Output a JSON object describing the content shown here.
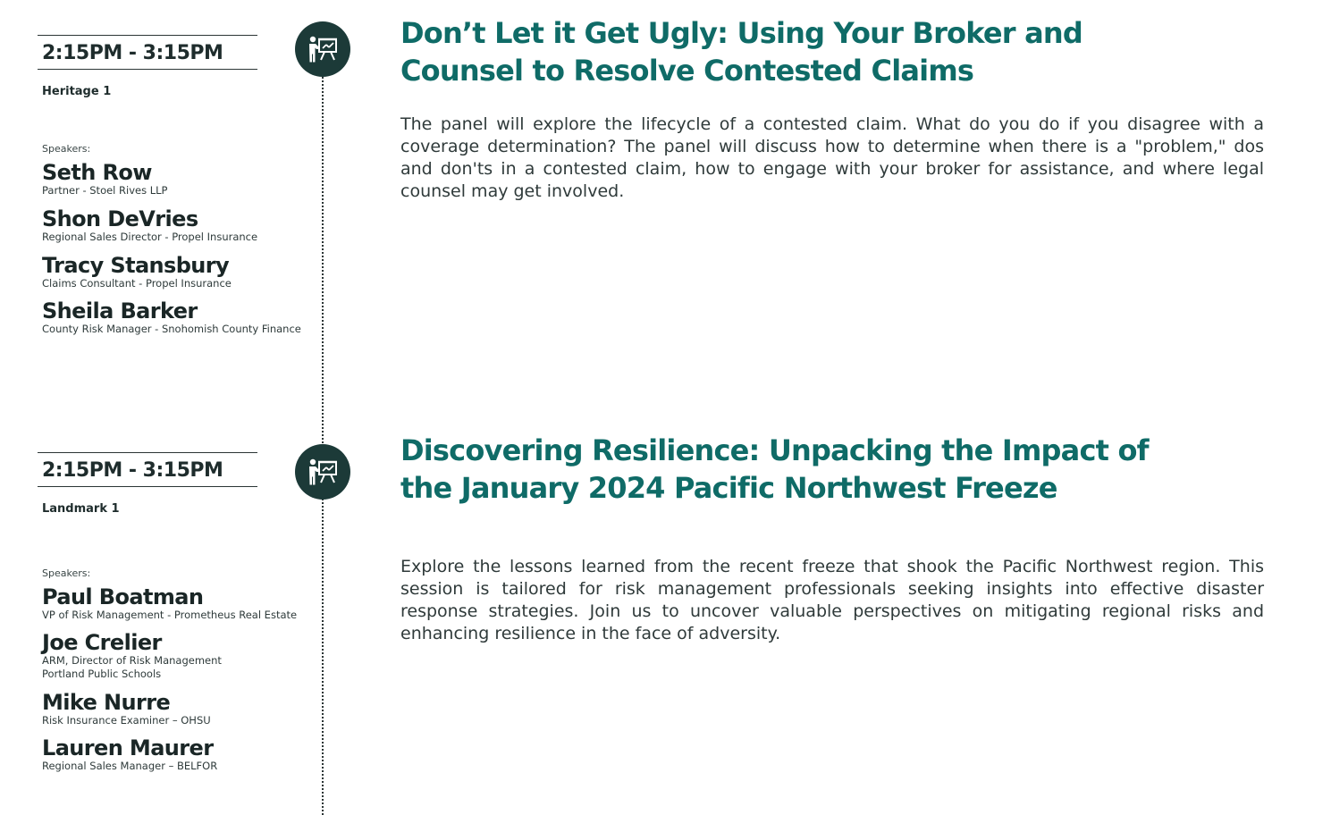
{
  "sessions": [
    {
      "time": "2:15PM - 3:15PM",
      "room": "Heritage 1",
      "speakers_label": "Speakers:",
      "icon": "presenter-icon",
      "title": "Don’t Let it Get Ugly: Using Your Broker and Counsel to Resolve Contested Claims",
      "description": "The panel will explore the lifecycle of a contested claim. What do you do if you disagree with a coverage determination? The panel will discuss how to determine when there is a \"problem,\" dos and don'ts in a contested claim, how to engage with your broker for assistance, and where legal counsel may get involved.",
      "speakers": [
        {
          "name": "Seth Row",
          "role": "Partner - Stoel Rives LLP"
        },
        {
          "name": "Shon DeVries",
          "role": "Regional Sales Director - Propel Insurance"
        },
        {
          "name": "Tracy Stansbury",
          "role": "Claims Consultant - Propel Insurance"
        },
        {
          "name": "Sheila Barker",
          "role": "County Risk Manager - Snohomish County Finance"
        }
      ]
    },
    {
      "time": "2:15PM - 3:15PM",
      "room": "Landmark 1",
      "speakers_label": "Speakers:",
      "icon": "presenter-icon",
      "title": "Discovering Resilience: Unpacking the Impact of the January 2024 Pacific Northwest Freeze",
      "description": "Explore the lessons learned from the recent freeze that shook the Pacific Northwest region. This session is tailored for risk management professionals seeking insights into effective disaster response strategies. Join us to uncover valuable perspectives on mitigating regional risks and enhancing resilience in the face of adversity.",
      "speakers": [
        {
          "name": "Paul Boatman",
          "role": "VP of Risk Management - Prometheus Real Estate"
        },
        {
          "name": "Joe Crelier",
          "role": "ARM, Director of Risk Management\nPortland Public Schools"
        },
        {
          "name": "Mike Nurre",
          "role": "Risk Insurance Examiner – OHSU"
        },
        {
          "name": "Lauren Maurer",
          "role": "Regional Sales Manager – BELFOR"
        }
      ]
    }
  ],
  "colors": {
    "title": "#0f6b67",
    "icon_bg": "#1c3a38",
    "text": "#1e2c2c"
  }
}
